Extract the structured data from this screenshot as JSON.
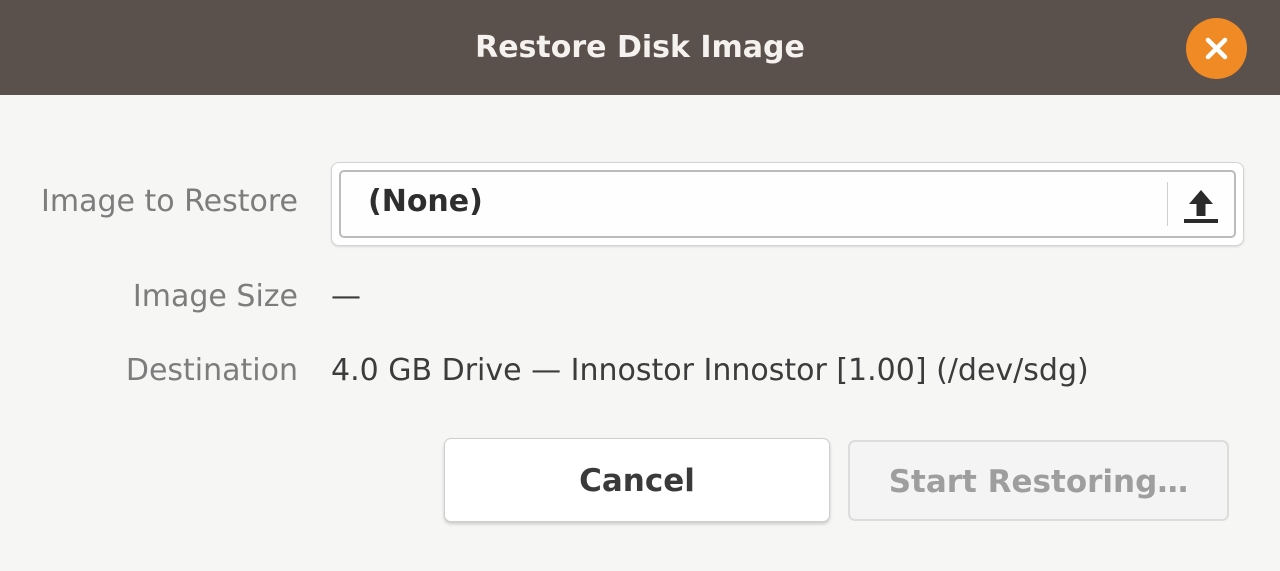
{
  "window": {
    "title": "Restore Disk Image",
    "close_icon": "close-icon",
    "titlebar_color": "#5b514c",
    "close_color": "#f08a24"
  },
  "form": {
    "image_label": "Image to Restore",
    "image_value": "(None)",
    "image_icon": "upload-icon",
    "size_label": "Image Size",
    "size_value": "—",
    "destination_label": "Destination",
    "destination_value": "4.0 GB Drive — Innostor Innostor [1.00] (/dev/sdg)"
  },
  "buttons": {
    "cancel": "Cancel",
    "start": "Start Restoring…"
  }
}
